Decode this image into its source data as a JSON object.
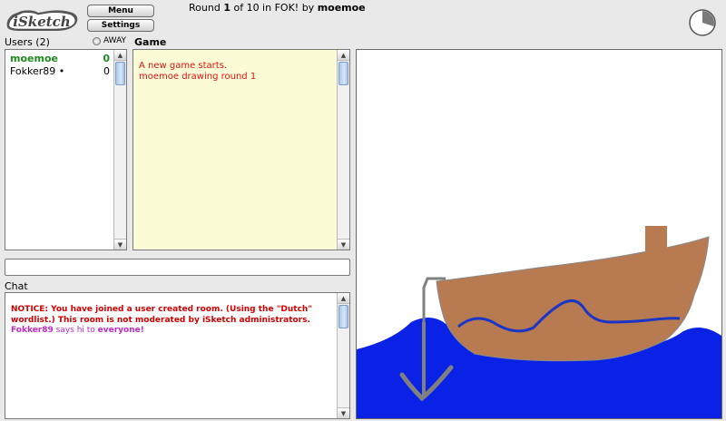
{
  "app": {
    "logo_text": "iSketch"
  },
  "toolbar": {
    "menu_label": "Menu",
    "settings_label": "Settings"
  },
  "round": {
    "prefix": "Round ",
    "current": "1",
    "middle": " of 10 in FOK! by ",
    "drawer": "moemoe",
    "progress_fraction": 0.3
  },
  "users": {
    "header": "Users (2)",
    "away_label": "AWAY",
    "list": [
      {
        "name": "moemoe",
        "score": "0"
      },
      {
        "name": "Fokker89 •",
        "score": "0"
      }
    ]
  },
  "game": {
    "header": "Game",
    "log": [
      "A new game starts.",
      "moemoe drawing round 1"
    ]
  },
  "chat": {
    "header": "Chat",
    "input_value": "",
    "notice": "NOTICE: You have joined a user created room. (Using the \"Dutch\" wordlist.) This room is not moderated by iSketch administrators.",
    "message": {
      "user": "Fokker89",
      "text": " says hi to ",
      "target": "everyone!"
    }
  },
  "colors": {
    "user_me": "#1f8a1f",
    "log_text": "#dd1111",
    "notice": "#d40000",
    "chat_user": "#c12ac9",
    "game_bg": "#fbfbd6",
    "sea": "#0a22e6",
    "boat": "#b87a50",
    "wave": "#1a35c8",
    "anchor": "#808080"
  }
}
